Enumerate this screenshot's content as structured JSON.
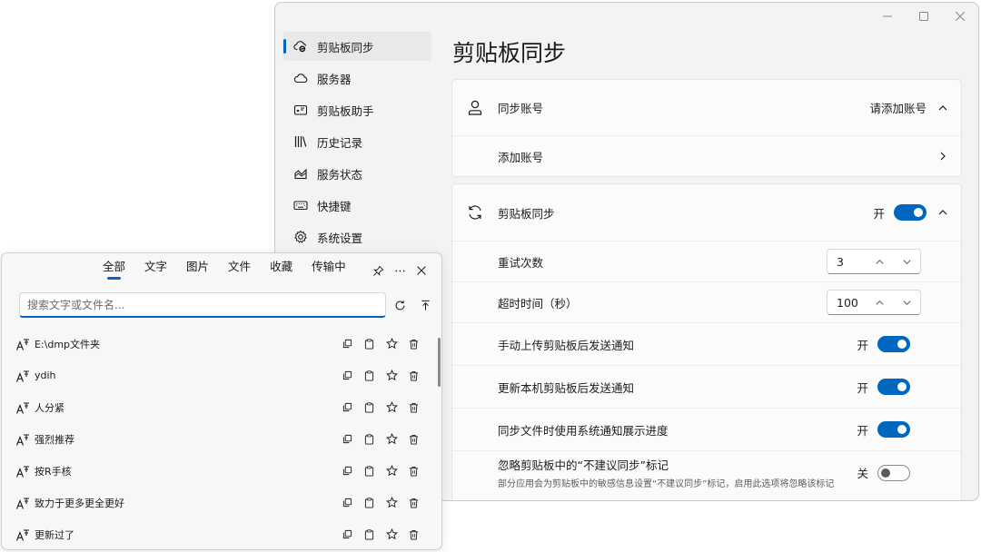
{
  "window": {
    "controls": [
      "minimize",
      "maximize",
      "close"
    ]
  },
  "nav": {
    "items": [
      {
        "label": "剪贴板同步",
        "icon": "cloud-sync-icon",
        "active": true
      },
      {
        "label": "服务器",
        "icon": "cloud-icon"
      },
      {
        "label": "剪贴板助手",
        "icon": "clipboard-assistant-icon"
      },
      {
        "label": "历史记录",
        "icon": "library-icon"
      },
      {
        "label": "服务状态",
        "icon": "area-chart-icon"
      },
      {
        "label": "快捷键",
        "icon": "keyboard-icon"
      },
      {
        "label": "系统设置",
        "icon": "gear-icon"
      }
    ]
  },
  "page": {
    "title": "剪贴板同步",
    "account": {
      "label": "同步账号",
      "value": "请添加账号",
      "add_label": "添加账号"
    },
    "sync": {
      "label": "剪贴板同步",
      "state_label": "开",
      "retry_label": "重试次数",
      "retry_value": "3",
      "timeout_label": "超时时间（秒）",
      "timeout_value": "100",
      "notify_upload_label": "手动上传剪贴板后发送通知",
      "notify_upload_state": "开",
      "notify_update_label": "更新本机剪贴板后发送通知",
      "notify_update_state": "开",
      "progress_label": "同步文件时使用系统通知展示进度",
      "progress_state": "开",
      "ignore_label": "忽略剪贴板中的“不建议同步”标记",
      "ignore_desc": "部分应用会为剪贴板中的敏感信息设置“不建议同步”标记，启用此选项将忽略该标记",
      "ignore_state": "关"
    }
  },
  "popup": {
    "tabs": [
      "全部",
      "文字",
      "图片",
      "文件",
      "收藏",
      "传输中"
    ],
    "active_tab": "全部",
    "search_placeholder": "搜索文字或文件名...",
    "items": [
      {
        "text": "E:\\dmp文件夹"
      },
      {
        "text": "ydih"
      },
      {
        "text": "人分紧"
      },
      {
        "text": "强烈推荐"
      },
      {
        "text": "按R手核"
      },
      {
        "text": "致力于更多更全更好"
      },
      {
        "text": "更新过了"
      }
    ]
  },
  "colors": {
    "accent": "#0067c0",
    "window_bg": "#f3f3f3",
    "card_bg": "#fbfbfb"
  }
}
